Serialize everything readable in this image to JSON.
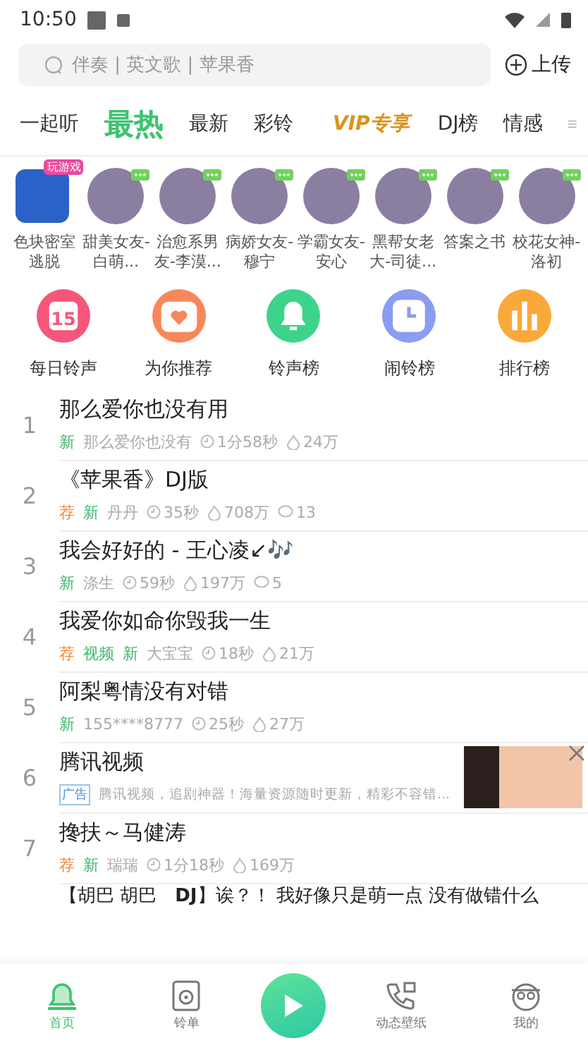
{
  "status_bar": {
    "time": "10:50"
  },
  "search": {
    "placeholder": "伴奏 | 英文歌 | 苹果香",
    "upload": "上传"
  },
  "tabs": [
    {
      "label": "一起听",
      "selected": false,
      "kind": "plain"
    },
    {
      "label": "最热",
      "selected": true,
      "kind": "plain"
    },
    {
      "label": "最新",
      "selected": false,
      "kind": "plain"
    },
    {
      "label": "彩铃",
      "selected": false,
      "kind": "plain"
    },
    {
      "label": "VIP专享",
      "selected": false,
      "kind": "vip"
    },
    {
      "label": "DJ榜",
      "selected": false,
      "kind": "plain"
    },
    {
      "label": "情感",
      "selected": false,
      "kind": "plain"
    }
  ],
  "characters": [
    {
      "name": "色块密室逃脱",
      "kind": "game",
      "badge": "玩游戏"
    },
    {
      "name": "甜美女友-白萌...",
      "kind": "avatar"
    },
    {
      "name": "治愈系男友-李漠...",
      "kind": "avatar"
    },
    {
      "name": "病娇女友-穆宁",
      "kind": "avatar"
    },
    {
      "name": "学霸女友-安心",
      "kind": "avatar"
    },
    {
      "name": "黑帮女老大-司徒...",
      "kind": "avatar"
    },
    {
      "name": "答案之书",
      "kind": "avatar"
    },
    {
      "name": "校花女神-洛初",
      "kind": "avatar"
    }
  ],
  "shortcuts": [
    {
      "label": "每日铃声",
      "kind": "calendar",
      "color": "#f5577a",
      "day": "15"
    },
    {
      "label": "为你推荐",
      "kind": "heart",
      "color": "#f7875a"
    },
    {
      "label": "铃声榜",
      "kind": "bell",
      "color": "#3ed38a"
    },
    {
      "label": "闹铃榜",
      "kind": "clock",
      "color": "#8c9cf0"
    },
    {
      "label": "排行榜",
      "kind": "bars",
      "color": "#f9a93a"
    }
  ],
  "songs": [
    {
      "rank": "1",
      "kind": "song",
      "title": "那么爱你也没有用",
      "tags": [
        {
          "label": "新",
          "color": "#3cb86a"
        }
      ],
      "author": "那么爱你也没有",
      "duration": "1分58秒",
      "likes": "24万"
    },
    {
      "rank": "2",
      "kind": "song",
      "title": "《苹果香》DJ版",
      "tags": [
        {
          "label": "荐",
          "color": "#f08a3c"
        },
        {
          "label": "新",
          "color": "#3cb86a"
        }
      ],
      "author": "丹丹",
      "duration": "35秒",
      "likes": "708万",
      "comments": "13"
    },
    {
      "rank": "3",
      "kind": "song",
      "title": "我会好好的 - 王心凌↙🎶",
      "tags": [
        {
          "label": "新",
          "color": "#3cb86a"
        }
      ],
      "author": "涤生",
      "duration": "59秒",
      "likes": "197万",
      "comments": "5"
    },
    {
      "rank": "4",
      "kind": "song",
      "title": "我爱你如命你毁我一生",
      "tags": [
        {
          "label": "荐",
          "color": "#f08a3c"
        },
        {
          "label": "视频",
          "color": "#3cb86a"
        },
        {
          "label": "新",
          "color": "#3cb86a"
        }
      ],
      "author": "大宝宝",
      "duration": "18秒",
      "likes": "21万"
    },
    {
      "rank": "5",
      "kind": "song",
      "title": "阿梨粤情没有对错",
      "tags": [
        {
          "label": "新",
          "color": "#3cb86a"
        }
      ],
      "author": "155****8777",
      "duration": "25秒",
      "likes": "27万"
    },
    {
      "rank": "6",
      "kind": "ad",
      "title": "腾讯视频",
      "ad_label": "广告",
      "description": "腾讯视频，追剧神器！海量资源随时更新，精彩不容错..."
    },
    {
      "rank": "7",
      "kind": "song",
      "title": "搀扶～马健涛",
      "tags": [
        {
          "label": "荐",
          "color": "#f08a3c"
        },
        {
          "label": "新",
          "color": "#3cb86a"
        }
      ],
      "author": "瑞瑞",
      "duration": "1分18秒",
      "likes": "169万"
    },
    {
      "kind": "song",
      "title": "【胡巴 胡巴　**DJ**】诶？！ 我好像只是萌一点 没有做错什么"
    }
  ],
  "bottom_nav": [
    {
      "label": "首页",
      "kind": "home",
      "selected": true
    },
    {
      "label": "铃单",
      "kind": "disc",
      "selected": false
    },
    {
      "kind": "play",
      "selected": false
    },
    {
      "label": "动态壁纸",
      "kind": "phone",
      "selected": false
    },
    {
      "label": "我的",
      "kind": "face",
      "selected": false
    }
  ]
}
